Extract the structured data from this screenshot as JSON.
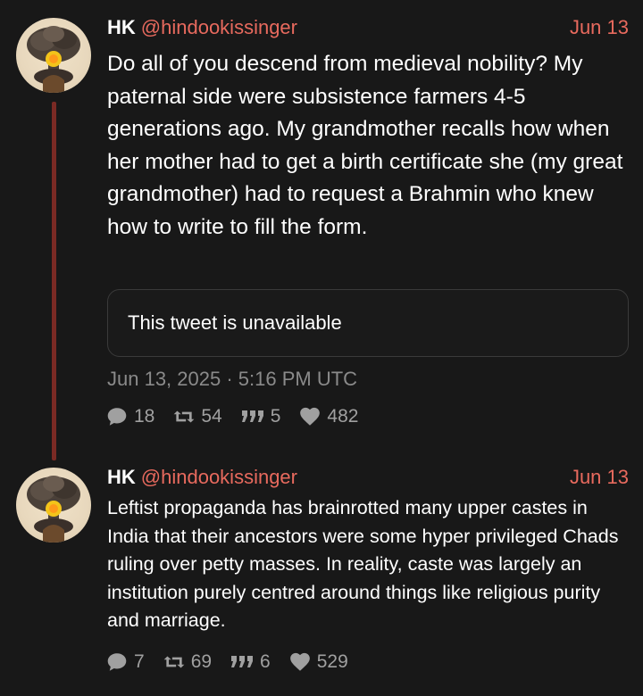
{
  "tweets": [
    {
      "author_name": "HK",
      "handle": "@hindookissinger",
      "date": "Jun 13",
      "text": "Do all of you descend from medieval nobility? My paternal side were subsistence farmers 4-5 generations ago. My grandmother recalls how when her mother had to get a birth certificate she (my great grandmother) had to request a Brahmin who knew how to write to fill the form.",
      "quoted_tweet": "This tweet is unavailable",
      "timestamp": "Jun 13, 2025 · 5:16 PM UTC",
      "stats": {
        "replies": "18",
        "retweets": "54",
        "quotes": "5",
        "likes": "482"
      },
      "icons": {
        "avatar": "mushroom-cloud-avatar",
        "reply": "comment-icon",
        "retweet": "retweet-icon",
        "quote": "quote-icon",
        "like": "heart-icon"
      }
    },
    {
      "author_name": "HK",
      "handle": "@hindookissinger",
      "date": "Jun 13",
      "text": "Leftist propaganda has brainrotted many upper castes in India that their ancestors were some hyper privileged Chads ruling over petty masses. In reality, caste was largely an institution purely centred around things like religious purity and marriage.",
      "stats": {
        "replies": "7",
        "retweets": "69",
        "quotes": "6",
        "likes": "529"
      },
      "icons": {
        "avatar": "mushroom-cloud-avatar",
        "reply": "comment-icon",
        "retweet": "retweet-icon",
        "quote": "quote-icon",
        "like": "heart-icon"
      }
    }
  ],
  "colors": {
    "background": "#181818",
    "accent": "#e86a5e",
    "thread_line": "#7a2a24",
    "muted": "#8a8a8a"
  }
}
